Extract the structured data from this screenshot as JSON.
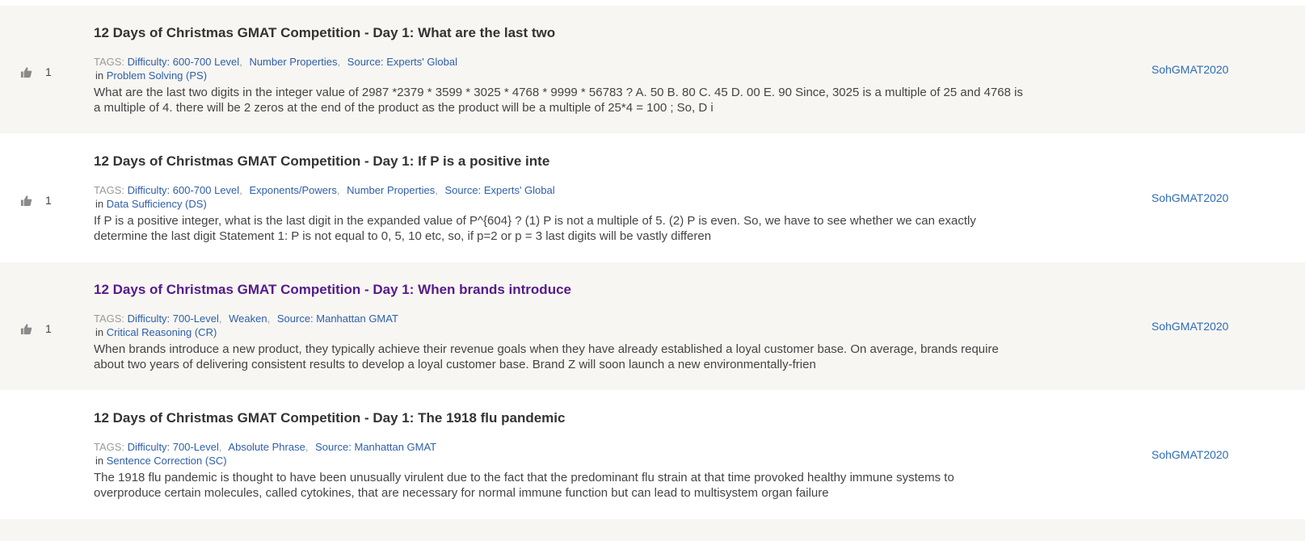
{
  "items": [
    {
      "votes": "1",
      "show_votes": true,
      "title": "12 Days of Christmas GMAT Competition - Day 1: What are the last two",
      "visited": false,
      "tags_label": "TAGS:",
      "tags": [
        "Difficulty: 600-700 Level",
        "Number Properties",
        "Source: Experts' Global"
      ],
      "in_label": "in",
      "category": "Problem Solving (PS)",
      "snippet": "What are the last two digits in the integer value of 2987 *2379 * 3599 * 3025 * 4768 * 9999 * 56783 ? A. 50 B. 80 C. 45 D. 00 E. 90 Since, 3025 is a multiple of 25 and 4768 is a multiple of 4. there will be 2 zeros at the end of the product as the product will be a multiple of 25*4 = 100 ; So, D i",
      "author": "SohGMAT2020"
    },
    {
      "votes": "1",
      "show_votes": true,
      "title": "12 Days of Christmas GMAT Competition - Day 1: If P is a positive inte",
      "visited": false,
      "tags_label": "TAGS:",
      "tags": [
        "Difficulty: 600-700 Level",
        "Exponents/Powers",
        "Number Properties",
        "Source: Experts' Global"
      ],
      "in_label": "in",
      "category": "Data Sufficiency (DS)",
      "snippet": "If P is a positive integer, what is the last digit in the expanded value of P^{604} ? (1) P is not a multiple of 5. (2) P is even. So, we have to see whether we can exactly determine the last digit Statement 1: P is not equal to 0, 5, 10 etc, so, if p=2 or p = 3 last digits will be vastly differen",
      "author": "SohGMAT2020"
    },
    {
      "votes": "1",
      "show_votes": true,
      "title": "12 Days of Christmas GMAT Competition - Day 1: When brands introduce",
      "visited": true,
      "tags_label": "TAGS:",
      "tags": [
        "Difficulty: 700-Level",
        "Weaken",
        "Source: Manhattan GMAT"
      ],
      "in_label": "in",
      "category": "Critical Reasoning (CR)",
      "snippet": "When brands introduce a new product, they typically achieve their revenue goals when they have already established a loyal customer base. On average, brands require about two years of delivering consistent results to develop a loyal customer base. Brand Z will soon launch a new environmentally-frien",
      "author": "SohGMAT2020"
    },
    {
      "votes": "",
      "show_votes": false,
      "title": "12 Days of Christmas GMAT Competition - Day 1: The 1918 flu pandemic",
      "visited": false,
      "tags_label": "TAGS:",
      "tags": [
        "Difficulty: 700-Level",
        "Absolute Phrase",
        "Source: Manhattan GMAT"
      ],
      "in_label": "in",
      "category": "Sentence Correction (SC)",
      "snippet": "The 1918 flu pandemic is thought to have been unusually virulent due to the fact that the predominant flu strain at that time provoked healthy immune systems to overproduce certain molecules, called cytokines, that are necessary for normal immune function but can lead to multisystem organ failure",
      "author": "SohGMAT2020"
    }
  ],
  "colors": {
    "shaded_row": "#f7f6f3",
    "link": "#2e5fa8",
    "visited_title": "#551a8b",
    "title": "#333333"
  }
}
